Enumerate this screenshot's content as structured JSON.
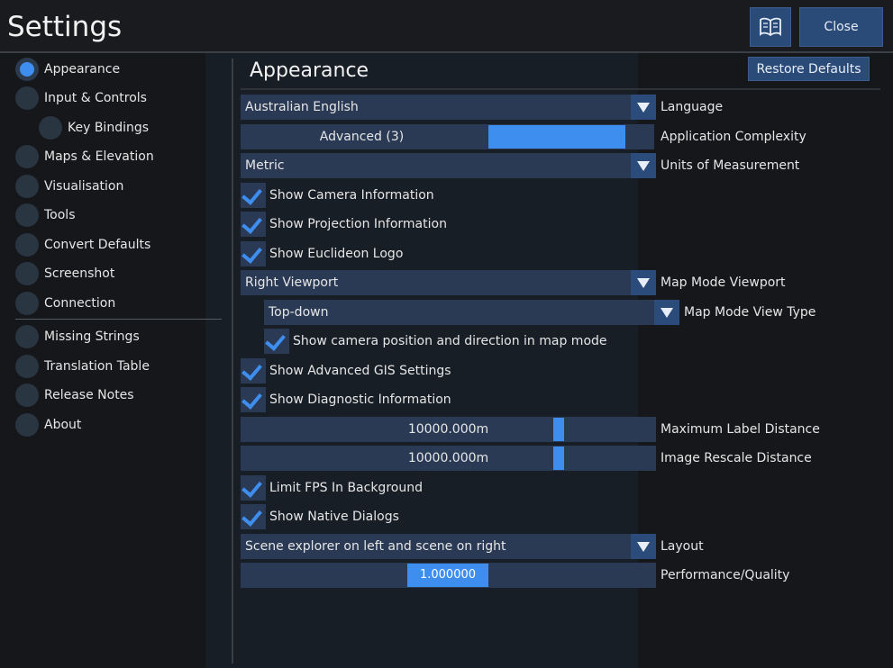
{
  "window": {
    "title": "Settings"
  },
  "toolbar": {
    "book_icon": "book-icon",
    "close_label": "Close",
    "restore_label": "Restore Defaults"
  },
  "sidebar": {
    "items": [
      {
        "label": "Appearance",
        "active": true
      },
      {
        "label": "Input & Controls"
      },
      {
        "label": "Key Bindings"
      },
      {
        "label": "Maps & Elevation"
      },
      {
        "label": "Visualisation"
      },
      {
        "label": "Tools"
      },
      {
        "label": "Convert Defaults"
      },
      {
        "label": "Screenshot"
      },
      {
        "label": "Connection"
      },
      {
        "label": "Missing Strings"
      },
      {
        "label": "Translation Table"
      },
      {
        "label": "Release Notes"
      },
      {
        "label": "About"
      }
    ]
  },
  "main": {
    "title": "Appearance",
    "language": {
      "value": "Australian English",
      "label": "Language"
    },
    "complexity": {
      "value": "Advanced (3)",
      "label": "Application Complexity",
      "fraction": 0.66
    },
    "units": {
      "value": "Metric",
      "label": "Units of Measurement"
    },
    "checks": {
      "camera_info": {
        "label": "Show Camera Information",
        "checked": true
      },
      "projection_info": {
        "label": "Show Projection Information",
        "checked": true
      },
      "euclideon_logo": {
        "label": "Show Euclideon Logo",
        "checked": true
      },
      "camera_map_mode": {
        "label": "Show camera position and direction in map mode",
        "checked": true
      },
      "advanced_gis": {
        "label": "Show Advanced GIS Settings",
        "checked": true
      },
      "diagnostic": {
        "label": "Show Diagnostic Information",
        "checked": true
      },
      "limit_fps": {
        "label": "Limit FPS In Background",
        "checked": true
      },
      "native_dialogs": {
        "label": "Show Native Dialogs",
        "checked": true
      }
    },
    "map_viewport": {
      "value": "Right Viewport",
      "label": "Map Mode Viewport"
    },
    "map_view_type": {
      "value": "Top-down",
      "label": "Map Mode View Type"
    },
    "max_label_distance": {
      "value": "10000.000m",
      "label": "Maximum Label Distance"
    },
    "image_rescale_distance": {
      "value": "10000.000m",
      "label": "Image Rescale Distance"
    },
    "layout": {
      "value": "Scene explorer on left and scene on right",
      "label": "Layout"
    },
    "performance": {
      "value": "1.000000",
      "label": "Performance/Quality"
    }
  },
  "colors": {
    "accent": "#3e8ef0",
    "field": "#2a3a55",
    "button": "#2a4a78"
  }
}
